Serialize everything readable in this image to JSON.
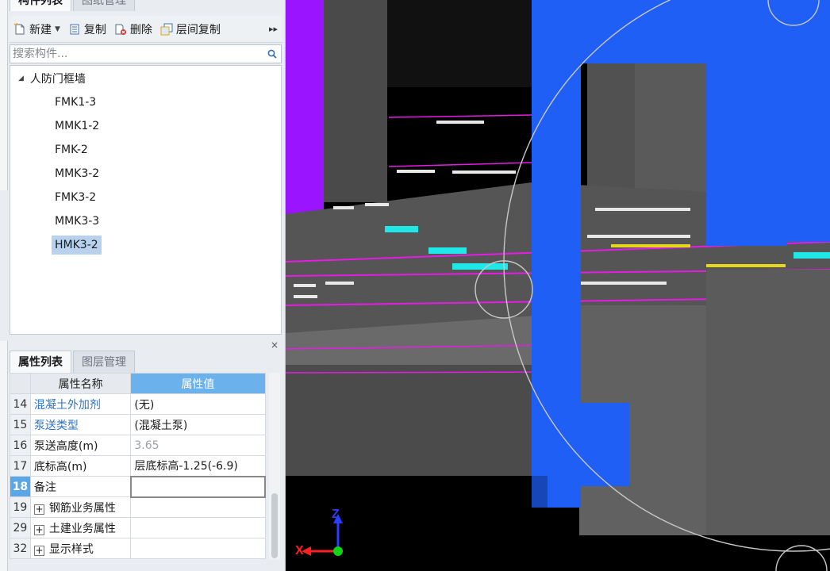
{
  "component_panel": {
    "tabs": [
      "构件列表",
      "图纸管理"
    ],
    "toolbar": {
      "new_label": "新建",
      "copy_label": "复制",
      "delete_label": "删除",
      "floor_copy_label": "层间复制",
      "more_glyph": "▸▸"
    },
    "search": {
      "placeholder": "搜索构件..."
    },
    "tree": {
      "root_label": "人防门框墙",
      "items": [
        "FMK1-3",
        "MMK1-2",
        "FMK-2",
        "MMK3-2",
        "FMK3-2",
        "MMK3-3",
        "HMK3-2"
      ],
      "selected": "HMK3-2"
    }
  },
  "property_panel": {
    "tabs": [
      "属性列表",
      "图层管理"
    ],
    "close_glyph": "×",
    "headers": {
      "name": "属性名称",
      "value": "属性值"
    },
    "rows": [
      {
        "num": "14",
        "name": "混凝土外加剂",
        "value": "(无)"
      },
      {
        "num": "15",
        "name": "泵送类型",
        "value": "(混凝土泵)"
      },
      {
        "num": "16",
        "name": "泵送高度(m)",
        "value": "3.65"
      },
      {
        "num": "17",
        "name": "底标高(m)",
        "value": "层底标高-1.25(-6.9)"
      },
      {
        "num": "18",
        "name": "备注",
        "value": ""
      },
      {
        "num": "19",
        "name": "钢筋业务属性",
        "value": ""
      },
      {
        "num": "29",
        "name": "土建业务属性",
        "value": ""
      },
      {
        "num": "32",
        "name": "显示样式",
        "value": ""
      }
    ]
  },
  "viewport": {
    "axis_labels": {
      "z": "Z",
      "x": "X"
    },
    "colors": {
      "background": "#000000",
      "wall_blue": "#1f5ff5",
      "wall_purple": "#9b14ff",
      "slab_gray": "#4a4a4a",
      "rebar_magenta": "#e51ce5",
      "cyan": "#20e8e8"
    }
  }
}
